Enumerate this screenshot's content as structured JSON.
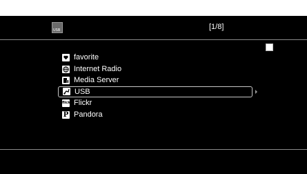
{
  "page_indicator": "[1/8]",
  "source_icon": {
    "name": "usb-source-icon",
    "text": "USB"
  },
  "menu": {
    "items": [
      {
        "label": "favorite",
        "icon": "heart-icon",
        "selected": false
      },
      {
        "label": "Internet Radio",
        "icon": "globe-icon",
        "selected": false
      },
      {
        "label": "Media Server",
        "icon": "media-server-icon",
        "selected": false
      },
      {
        "label": "USB",
        "icon": "usb-icon",
        "selected": true
      },
      {
        "label": "Flickr",
        "icon": "flickr-icon",
        "selected": false
      },
      {
        "label": "Pandora",
        "icon": "pandora-icon",
        "selected": false
      }
    ]
  },
  "colors": {
    "background": "#000000",
    "text": "#ffffff",
    "divider": "#8a8a8a",
    "selection_border": "#c8c8c8"
  }
}
